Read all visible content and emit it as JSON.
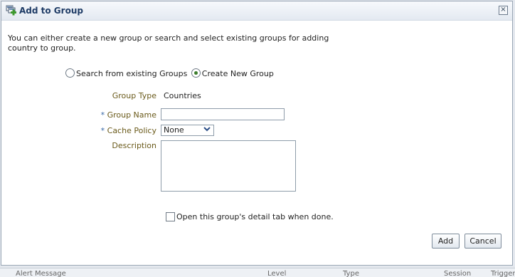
{
  "dialog": {
    "title": "Add to Group",
    "close_glyph": "×",
    "intro": "You can either create a new group or search and select existing groups for adding country to group."
  },
  "mode": {
    "options": [
      {
        "label": "Search from existing Groups",
        "selected": false
      },
      {
        "label": "Create New Group",
        "selected": true
      }
    ]
  },
  "form": {
    "group_type": {
      "label": "Group Type",
      "value": "Countries"
    },
    "group_name": {
      "required_mark": "*",
      "label": "Group Name",
      "value": ""
    },
    "cache_policy": {
      "required_mark": "*",
      "label": "Cache Policy",
      "value": "None"
    },
    "description": {
      "label": "Description",
      "value": ""
    },
    "open_detail": {
      "label": "Open this group's detail tab when done.",
      "checked": false
    }
  },
  "actions": {
    "add": "Add",
    "cancel": "Cancel"
  },
  "background_page": {
    "cells": [
      "Alert Message",
      "Level",
      "Type",
      "Session",
      "Trigger"
    ]
  },
  "colors": {
    "title": "#1f3c66",
    "field_label": "#6a5a1a",
    "required": "#3a6aa8",
    "radio_selected": "#3b7d2c"
  },
  "icons": {
    "title": "add-group-icon",
    "close": "close-icon",
    "dropdown": "chevron-down-icon"
  }
}
